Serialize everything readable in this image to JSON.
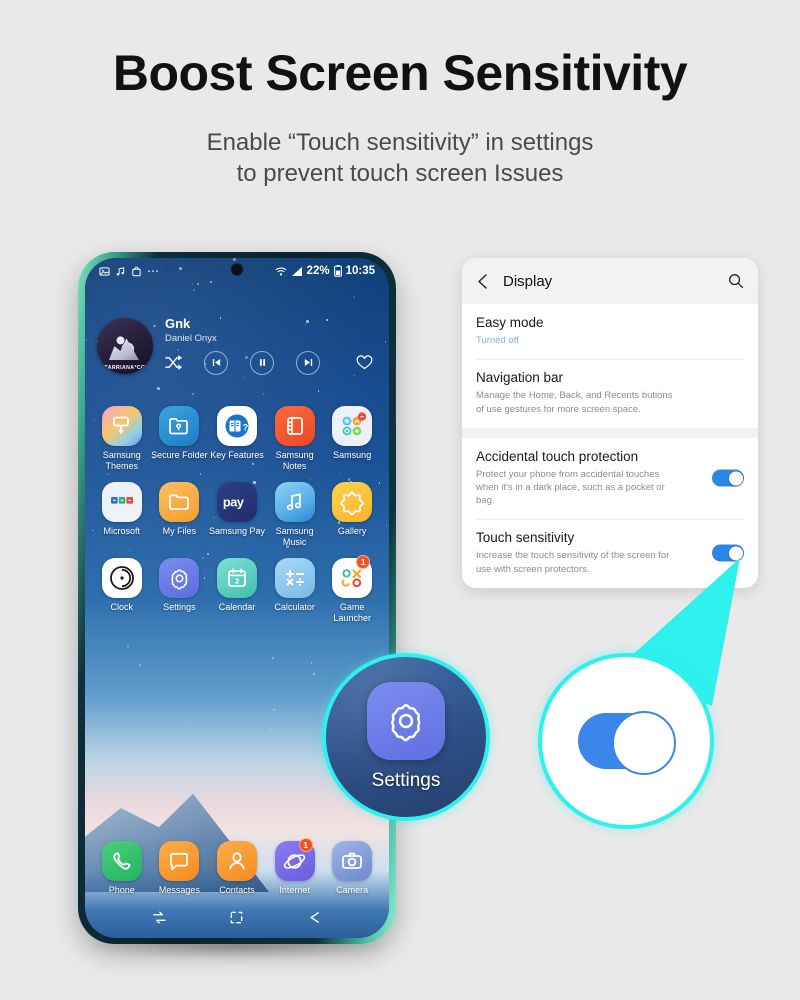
{
  "page": {
    "title": "Boost Screen Sensitivity",
    "subtitle_line1": "Enable “Touch sensitivity” in settings",
    "subtitle_line2": "to prevent touch screen Issues",
    "background_color": "#e9e9e9",
    "accent_color": "#2ef0ec"
  },
  "phone": {
    "status_bar": {
      "left_icons": [
        "image-icon",
        "music-note-icon",
        "shopping-bag-icon",
        "more-dots-icon"
      ],
      "wifi_icon": "wifi-icon",
      "signal_icon": "signal-icon",
      "battery_percent": "22%",
      "battery_icon": "battery-icon",
      "time": "10:35"
    },
    "music_widget": {
      "album_art_text": "TARRIANA*CO",
      "track_title": "Gnk",
      "artist": "Daniel Onyx",
      "controls": [
        "shuffle-icon",
        "previous-icon",
        "pause-icon",
        "next-icon",
        "favorite-heart-icon"
      ]
    },
    "app_grid": [
      {
        "label": "Samsung Themes",
        "icon": "samsung-themes-icon",
        "badge": null
      },
      {
        "label": "Secure Folder",
        "icon": "secure-folder-icon",
        "badge": null
      },
      {
        "label": "Key Features",
        "icon": "key-features-icon",
        "badge": null
      },
      {
        "label": "Samsung Notes",
        "icon": "samsung-notes-icon",
        "badge": null
      },
      {
        "label": "Samsung",
        "icon": "samsung-folder-icon",
        "badge": null
      },
      {
        "label": "Microsoft",
        "icon": "microsoft-folder-icon",
        "badge": null
      },
      {
        "label": "My Files",
        "icon": "my-files-icon",
        "badge": null
      },
      {
        "label": "Samsung Pay",
        "icon": "samsung-pay-icon",
        "badge": null
      },
      {
        "label": "Samsung Music",
        "icon": "samsung-music-icon",
        "badge": null
      },
      {
        "label": "Gallery",
        "icon": "gallery-icon",
        "badge": null
      },
      {
        "label": "Clock",
        "icon": "clock-icon",
        "badge": null
      },
      {
        "label": "Settings",
        "icon": "settings-gear-icon",
        "badge": null
      },
      {
        "label": "Calendar",
        "icon": "calendar-icon",
        "badge": null
      },
      {
        "label": "Calculator",
        "icon": "calculator-icon",
        "badge": null
      },
      {
        "label": "Game Launcher",
        "icon": "game-launcher-icon",
        "badge": "1"
      }
    ],
    "dock": [
      {
        "label": "Phone",
        "icon": "phone-icon",
        "badge": null
      },
      {
        "label": "Messages",
        "icon": "messages-icon",
        "badge": null
      },
      {
        "label": "Contacts",
        "icon": "contacts-icon",
        "badge": null
      },
      {
        "label": "Internet",
        "icon": "internet-icon",
        "badge": "1"
      },
      {
        "label": "Camera",
        "icon": "camera-icon",
        "badge": null
      }
    ],
    "nav_bar": [
      "recents-icon",
      "home-icon",
      "back-icon"
    ]
  },
  "settings_panel": {
    "back_icon": "back-chevron-icon",
    "header_title": "Display",
    "search_icon": "search-icon",
    "items": [
      {
        "title": "Easy mode",
        "description": "Turned off",
        "description_style": "blue",
        "toggle": null
      },
      {
        "title": "Navigation bar",
        "description": "Manage the Home, Back, and Recents butions of use gestures for more screen space.",
        "description_style": "gray",
        "toggle": null
      },
      {
        "title": "Accidental touch protection",
        "description": "Protect your phone from accidental touches when it's in a dark place, such as a pocket or bag.",
        "description_style": "gray",
        "toggle": "on"
      },
      {
        "title": "Touch sensitivity",
        "description": "Increase the touch sensitivity of the screen for use with screen protectors.",
        "description_style": "gray",
        "toggle": "on"
      }
    ]
  },
  "magnifiers": {
    "settings": {
      "label": "Settings",
      "icon": "settings-gear-icon"
    },
    "toggle": {
      "state": "on",
      "icon": "toggle-switch-on-icon"
    }
  }
}
